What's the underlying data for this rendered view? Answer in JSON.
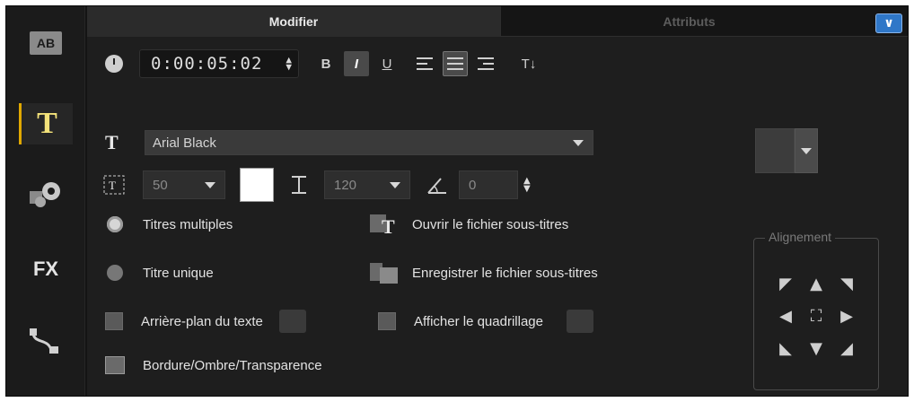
{
  "rail": {
    "items": [
      {
        "id": "ab",
        "label": "AB"
      },
      {
        "id": "text",
        "label": "T"
      },
      {
        "id": "motion",
        "label": ""
      },
      {
        "id": "fx",
        "label": "FX"
      },
      {
        "id": "path",
        "label": ""
      }
    ]
  },
  "tabs": {
    "modifier": "Modifier",
    "attributs": "Attributs"
  },
  "toolbar": {
    "timecode": "0:00:05:02",
    "bold": "B",
    "italic": "I",
    "underline": "U",
    "text_direction": "T↓"
  },
  "font": {
    "name": "Arial Black"
  },
  "size": {
    "font_size": "50",
    "line_spacing": "120",
    "rotation": "0",
    "text_color": "#ffffff"
  },
  "options": {
    "multi_titles": "Titres multiples",
    "single_title": "Titre unique",
    "open_subtitles": "Ouvrir le fichier sous-titres",
    "save_subtitles": "Enregistrer le fichier sous-titres",
    "text_background": "Arrière-plan du texte",
    "show_grid": "Afficher le quadrillage",
    "border_shadow": "Bordure/Ombre/Transparence"
  },
  "alignment": {
    "legend": "Alignement",
    "cells": [
      "◤",
      "▲",
      "◥",
      "◀",
      "⛶",
      "▶",
      "◣",
      "▼",
      "◢"
    ]
  }
}
